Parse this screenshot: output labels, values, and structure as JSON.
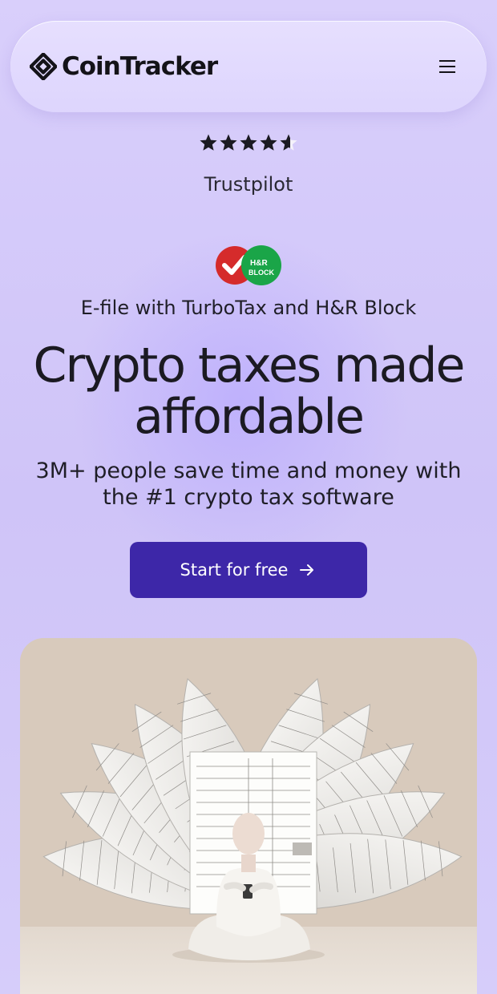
{
  "header": {
    "brand": "CoinTracker",
    "logo_icon": "cointracker-logo-icon",
    "menu_icon": "hamburger-menu-icon"
  },
  "rating": {
    "stars": 4.5,
    "max": 5,
    "source": "Trustpilot"
  },
  "partners": {
    "turbotax_icon": "turbotax-check-icon",
    "hrblock_badge": "H&R BLOCK",
    "efile_text": "E-file with TurboTax and H&R Block"
  },
  "hero": {
    "title": "Crypto taxes made affordable",
    "subtitle": "3M+ people save time and money with the #1 crypto tax software",
    "cta_label": "Start for free",
    "cta_icon": "arrow-right-icon"
  },
  "colors": {
    "background": "#d4c9fa",
    "cta": "#3d27a8",
    "turbotax_red": "#d52b2b",
    "hrblock_green": "#1aa548"
  }
}
